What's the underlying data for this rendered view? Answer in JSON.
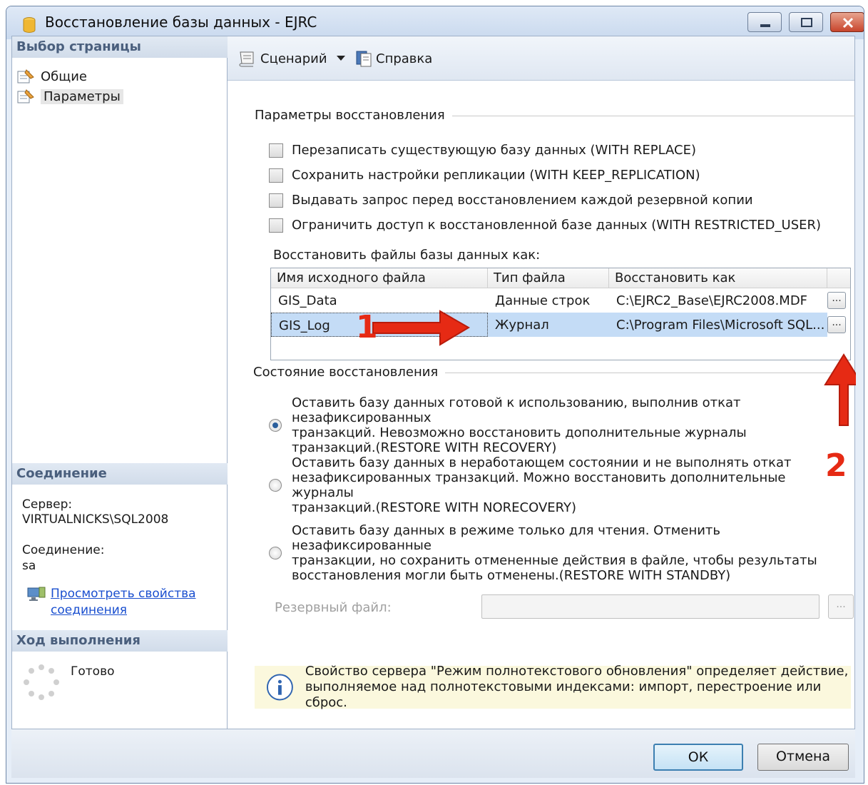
{
  "window": {
    "title": "Восстановление базы данных - EJRC"
  },
  "left": {
    "select_page_header": "Выбор страницы",
    "nav": [
      {
        "label": "Общие"
      },
      {
        "label": "Параметры"
      }
    ],
    "connection_header": "Соединение",
    "server_label": "Сервер:",
    "server_value": "VIRTUALNICKS\\SQL2008",
    "connection_label": "Соединение:",
    "connection_value": "sa",
    "view_props_line1": "Просмотреть свойства",
    "view_props_line2": "соединения",
    "progress_header": "Ход выполнения",
    "progress_status": "Готово"
  },
  "toolbar": {
    "script_label": "Сценарий",
    "help_label": "Справка"
  },
  "restore_options": {
    "title": "Параметры восстановления",
    "checkboxes": [
      {
        "label": "Перезаписать существующую базу данных (WITH REPLACE)",
        "checked": false
      },
      {
        "label": "Сохранить настройки репликации (WITH KEEP_REPLICATION)",
        "checked": false
      },
      {
        "label": "Выдавать запрос перед восстановлением каждой резервной копии",
        "checked": false
      },
      {
        "label": "Ограничить доступ к восстановленной базе данных (WITH RESTRICTED_USER)",
        "checked": false
      }
    ],
    "files_label": "Восстановить файлы базы данных как:",
    "columns": [
      "Имя исходного файла",
      "Тип файла",
      "Восстановить как"
    ],
    "rows": [
      {
        "name": "GIS_Data",
        "type": "Данные строк",
        "restore_as": "C:\\EJRC2_Base\\EJRC2008.MDF",
        "selected": false
      },
      {
        "name": "GIS_Log",
        "type": "Журнал",
        "restore_as": "C:\\Program Files\\Microsoft SQL...",
        "selected": true
      }
    ],
    "browse_label": "..."
  },
  "recovery_state": {
    "title": "Состояние восстановления",
    "options": [
      {
        "line1": "Оставить базу данных готовой к использованию, выполнив откат незафиксированных",
        "line2": "транзакций. Невозможно восстановить дополнительные журналы",
        "line3": "транзакций.(RESTORE WITH RECOVERY)",
        "selected": true
      },
      {
        "line1": "Оставить базу данных в неработающем состоянии и не выполнять откат",
        "line2": "незафиксированных транзакций. Можно восстановить дополнительные журналы",
        "line3": "транзакций.(RESTORE WITH NORECOVERY)",
        "selected": false
      },
      {
        "line1": "Оставить базу данных в режиме только для чтения. Отменить незафиксированные",
        "line2": "транзакции, но сохранить отмененные действия в файле, чтобы результаты",
        "line3": "восстановления могли быть отменены.(RESTORE WITH STANDBY)",
        "selected": false
      }
    ],
    "standby_file_label": "Резервный файл:",
    "standby_file_value": "",
    "browse_label": "..."
  },
  "info": {
    "line1": "Свойство сервера \"Режим полнотекстового обновления\" определяет действие,",
    "line2": "выполняемое над полнотекстовыми индексами: импорт, перестроение или сброс."
  },
  "buttons": {
    "ok": "ОК",
    "cancel": "Отмена"
  },
  "annotations": {
    "marker1": "1",
    "marker2": "2",
    "arrow_color": "#e62a14"
  }
}
